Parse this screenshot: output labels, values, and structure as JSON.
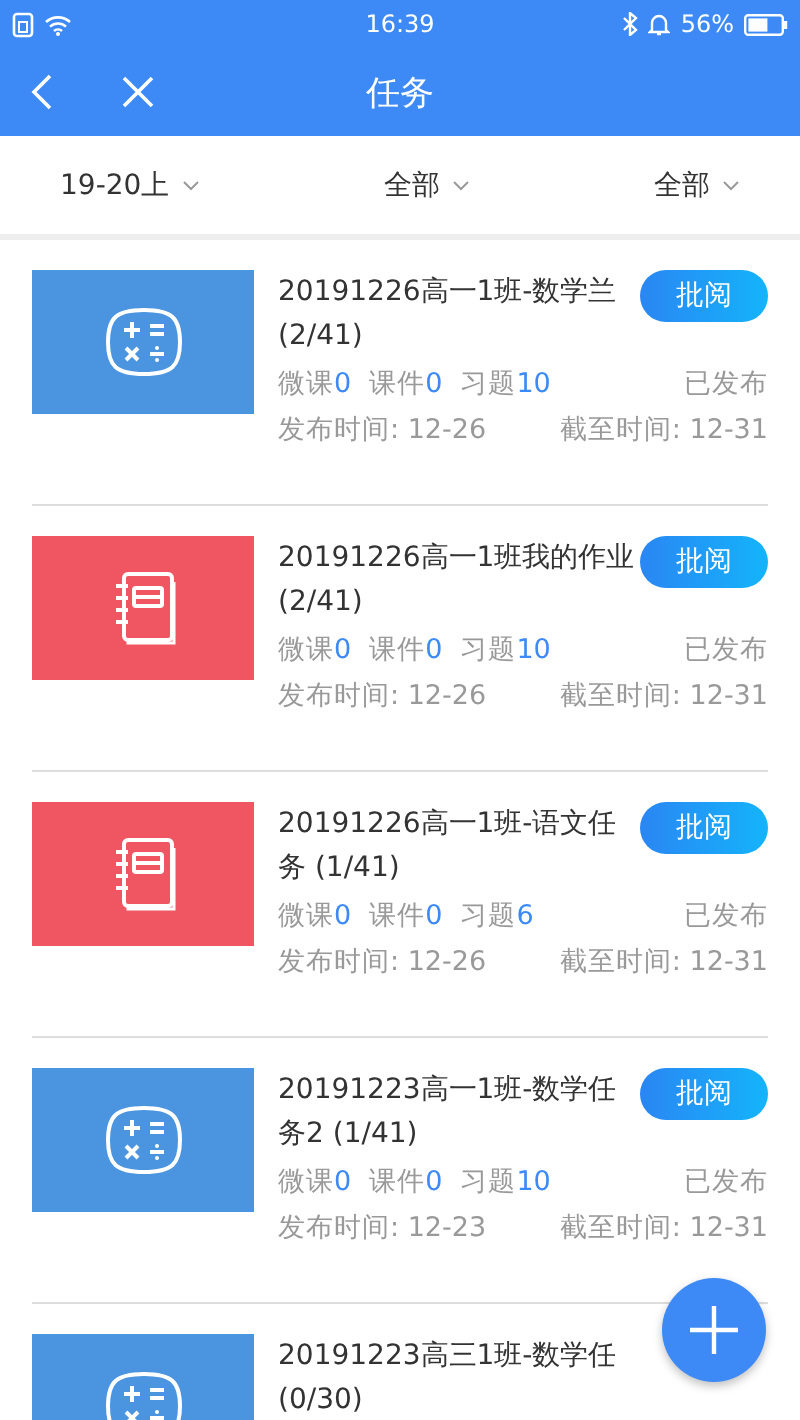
{
  "status_bar": {
    "time": "16:39",
    "battery": "56%"
  },
  "nav": {
    "title": "任务"
  },
  "filters": [
    {
      "label": "19-20上"
    },
    {
      "label": "全部"
    },
    {
      "label": "全部"
    }
  ],
  "tasks": [
    {
      "kind": "math",
      "title": "20191226高一1班-数学兰",
      "count": "(2/41)",
      "action": "批阅",
      "stats": [
        {
          "label": "微课",
          "value": "0"
        },
        {
          "label": "课件",
          "value": "0"
        },
        {
          "label": "习题",
          "value": "10"
        }
      ],
      "status": "已发布",
      "published": "发布时间: 12-26",
      "deadline": "截至时间: 12-31"
    },
    {
      "kind": "notebook",
      "title": "20191226高一1班我的作业",
      "count": "(2/41)",
      "action": "批阅",
      "stats": [
        {
          "label": "微课",
          "value": "0"
        },
        {
          "label": "课件",
          "value": "0"
        },
        {
          "label": "习题",
          "value": "10"
        }
      ],
      "status": "已发布",
      "published": "发布时间: 12-26",
      "deadline": "截至时间: 12-31"
    },
    {
      "kind": "notebook",
      "title": "20191226高一1班-语文任务",
      "count": "(1/41)",
      "action": "批阅",
      "stats": [
        {
          "label": "微课",
          "value": "0"
        },
        {
          "label": "课件",
          "value": "0"
        },
        {
          "label": "习题",
          "value": "6"
        }
      ],
      "status": "已发布",
      "published": "发布时间: 12-26",
      "deadline": "截至时间: 12-31"
    },
    {
      "kind": "math",
      "title": "20191223高一1班-数学任务2",
      "count": "(1/41)",
      "action": "批阅",
      "stats": [
        {
          "label": "微课",
          "value": "0"
        },
        {
          "label": "课件",
          "value": "0"
        },
        {
          "label": "习题",
          "value": "10"
        }
      ],
      "status": "已发布",
      "published": "发布时间: 12-23",
      "deadline": "截至时间: 12-31"
    },
    {
      "kind": "math",
      "title": "20191223高三1班-数学任",
      "count": "(0/30)"
    }
  ]
}
